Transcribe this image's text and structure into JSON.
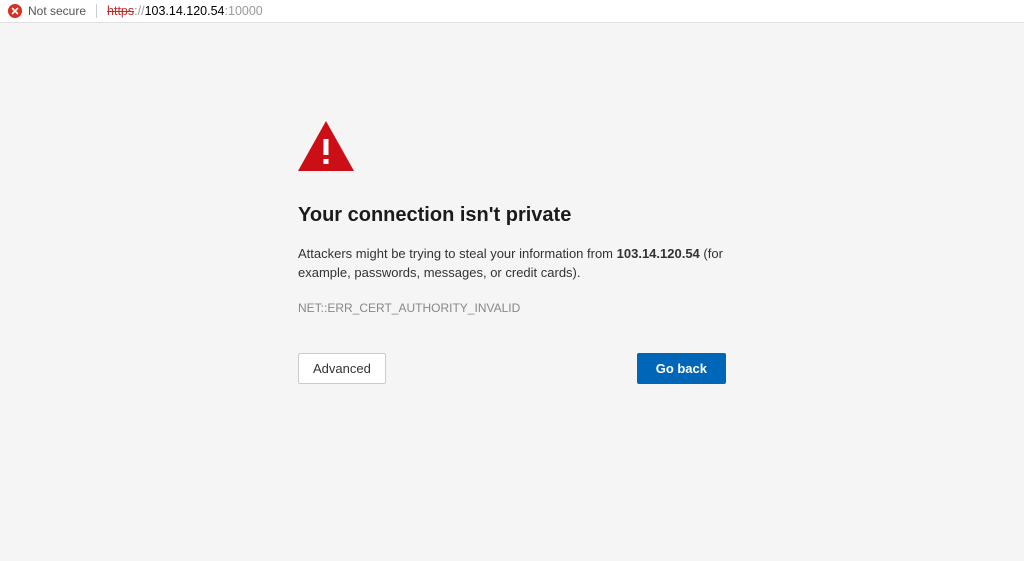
{
  "address_bar": {
    "security_label": "Not secure",
    "url_protocol": "https",
    "url_proto_sep": "://",
    "url_host": "103.14.120.54",
    "url_port": ":10000"
  },
  "interstitial": {
    "title": "Your connection isn't private",
    "description_prefix": "Attackers might be trying to steal your information from ",
    "description_host": "103.14.120.54",
    "description_suffix": " (for example, passwords, messages, or credit cards).",
    "error_code": "NET::ERR_CERT_AUTHORITY_INVALID",
    "advanced_label": "Advanced",
    "goback_label": "Go back"
  }
}
